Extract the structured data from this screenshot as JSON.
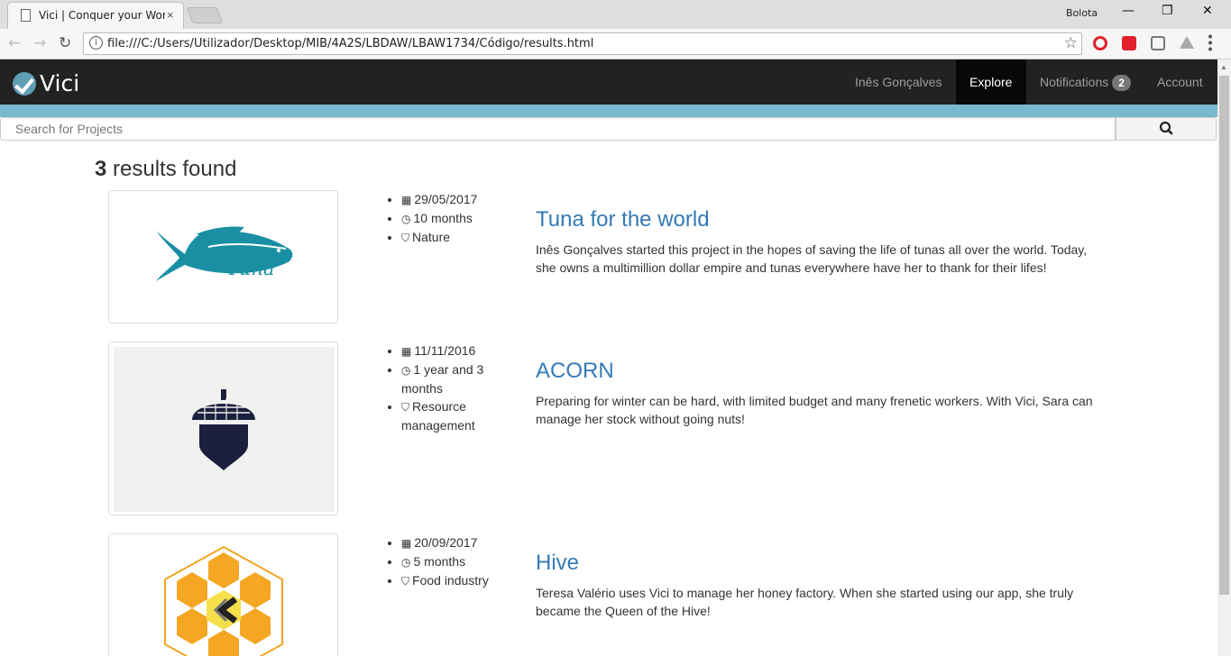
{
  "browser": {
    "tab_title": "Vici | Conquer your World",
    "tab_close": "×",
    "profile_name": "Bolota",
    "url": "file:///C:/Users/Utilizador/Desktop/MIB/4A2S/LBDAW/LBAW1734/Código/results.html",
    "icons": [
      "back-icon",
      "forward-icon",
      "reload-icon",
      "info-icon",
      "star-icon",
      "opera-icon",
      "ext-red-icon",
      "ext-mail-icon",
      "drive-icon",
      "menu-icon"
    ]
  },
  "navbar": {
    "brand": "Vici",
    "user": "Inês Gonçalves",
    "explore": "Explore",
    "notifications": "Notifications",
    "notifications_count": "2",
    "account": "Account"
  },
  "search": {
    "placeholder": "Search for Projects"
  },
  "results": {
    "count": "3",
    "label": "results found"
  },
  "projects": [
    {
      "title": "Tuna for the world",
      "date": "29/05/2017",
      "duration": "10 months",
      "tag": "Nature",
      "image_text": "Tuna",
      "description": "Inês Gonçalves started this project in the hopes of saving the life of tunas all over the world. Today, she owns a multimillion dollar empire and tunas everywhere have her to thank for their lifes!"
    },
    {
      "title": "ACORN",
      "date": "11/11/2016",
      "duration": "1 year and 3 months",
      "tag": "Resource management",
      "description": "Preparing for winter can be hard, with limited budget and many frenetic workers. With Vici, Sara can manage her stock without going nuts!"
    },
    {
      "title": "Hive",
      "date": "20/09/2017",
      "duration": "5 months",
      "tag": "Food industry",
      "description": "Teresa Valério uses Vici to manage her honey factory. When she started using our app, she truly became the Queen of the Hive!"
    }
  ],
  "colors": {
    "navbar": "#222222",
    "band": "#7ab8cf",
    "link": "#337ab7",
    "tuna": "#1a8fa3",
    "acorn": "#1c1f3d",
    "hive_orange": "#f5a623"
  }
}
